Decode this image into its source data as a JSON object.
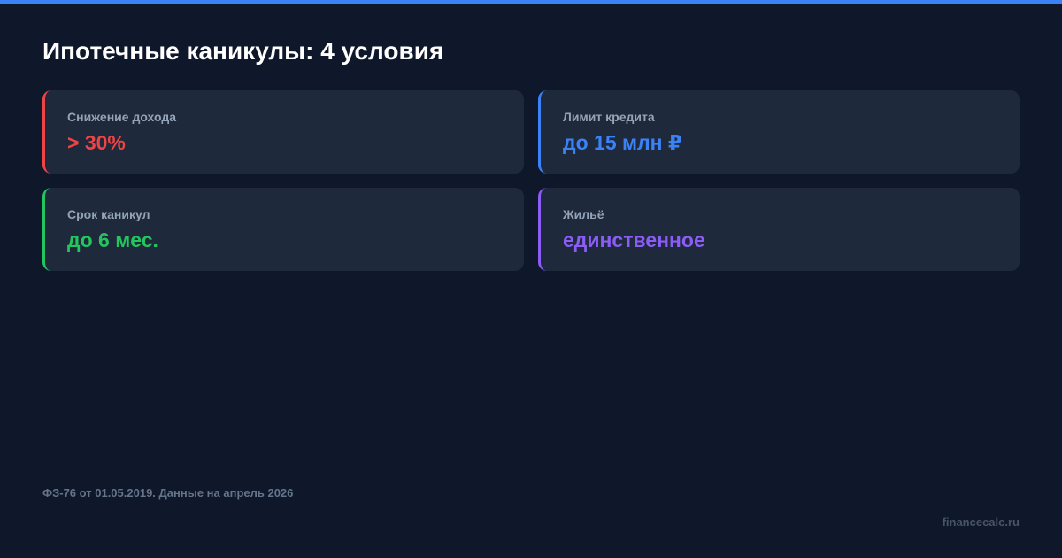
{
  "colors": {
    "background": "#0f172a",
    "top_bar": "#3b82f6",
    "card_background": "#1e293b",
    "label": "#94a3b8"
  },
  "title": "Ипотечные каникулы: 4 условия",
  "cards": [
    {
      "label": "Снижение дохода",
      "value": "> 30%",
      "accent": "#ef4444"
    },
    {
      "label": "Лимит кредита",
      "value": "до 15 млн ₽",
      "accent": "#3b82f6"
    },
    {
      "label": "Срок каникул",
      "value": "до 6 мес.",
      "accent": "#22c55e"
    },
    {
      "label": "Жильё",
      "value": "единственное",
      "accent": "#8b5cf6"
    }
  ],
  "footnote": "ФЗ-76 от 01.05.2019. Данные на апрель 2026",
  "site": "financecalc.ru"
}
